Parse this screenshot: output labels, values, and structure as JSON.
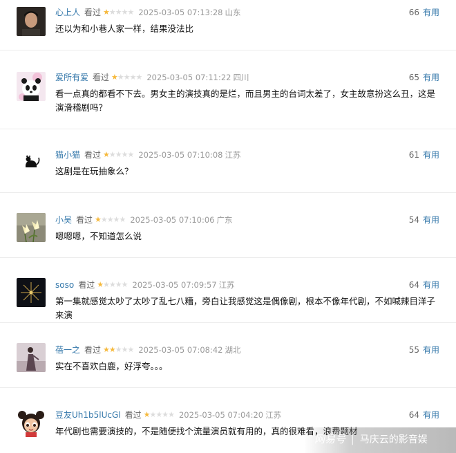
{
  "reviews": [
    {
      "user": "心上人",
      "status": "看过",
      "rating": 1,
      "time": "2025-03-05 07:13:28",
      "location": "山东",
      "votes": "66",
      "useful_label": "有用",
      "text": "还以为和小巷人家一样，结果没法比",
      "avatar": "portrait-man-avatar"
    },
    {
      "user": "爱所有爱",
      "status": "看过",
      "rating": 1,
      "time": "2025-03-05 07:11:22",
      "location": "四川",
      "votes": "65",
      "useful_label": "有用",
      "text": "看一点真的都看不下去。男女主的演技真的是烂，而且男主的台词太差了，女主故意扮这么丑，这是演滑稽剧吗？",
      "avatar": "panda-avatar"
    },
    {
      "user": "猫小猫",
      "status": "看过",
      "rating": 1,
      "time": "2025-03-05 07:10:08",
      "location": "江苏",
      "votes": "61",
      "useful_label": "有用",
      "text": "这剧是在玩抽象么？",
      "avatar": "black-cat-avatar"
    },
    {
      "user": "小吴",
      "status": "看过",
      "rating": 1,
      "time": "2025-03-05 07:10:06",
      "location": "广东",
      "votes": "54",
      "useful_label": "有用",
      "text": "嗯嗯嗯，不知道怎么说",
      "avatar": "lily-flower-avatar"
    },
    {
      "user": "soso",
      "status": "看过",
      "rating": 1,
      "time": "2025-03-05 07:09:57",
      "location": "江苏",
      "votes": "64",
      "useful_label": "有用",
      "text": "第一集就感觉太吵了太吵了乱七八糟，旁白让我感觉这是偶像剧，根本不像年代剧，不如喊辣目洋子来演",
      "avatar": "fireworks-avatar"
    },
    {
      "user": "蓓一之",
      "status": "看过",
      "rating": 2,
      "time": "2025-03-05 07:08:42",
      "location": "湖北",
      "votes": "55",
      "useful_label": "有用",
      "text": "实在不喜欢白鹿，好浮夸。。。",
      "avatar": "woman-photo-avatar"
    },
    {
      "user": "豆友Uh1b5lUcGl",
      "status": "看过",
      "rating": 1,
      "time": "2025-03-05 07:04:20",
      "location": "江苏",
      "votes": "64",
      "useful_label": "有用",
      "text": "年代剧也需要演技的，不是随便找个流量演员就有用的，真的很难看，浪费题材",
      "avatar": "cartoon-girl-avatar"
    }
  ],
  "watermark": {
    "logo": "网易号",
    "author": "马庆云的影音娱"
  }
}
